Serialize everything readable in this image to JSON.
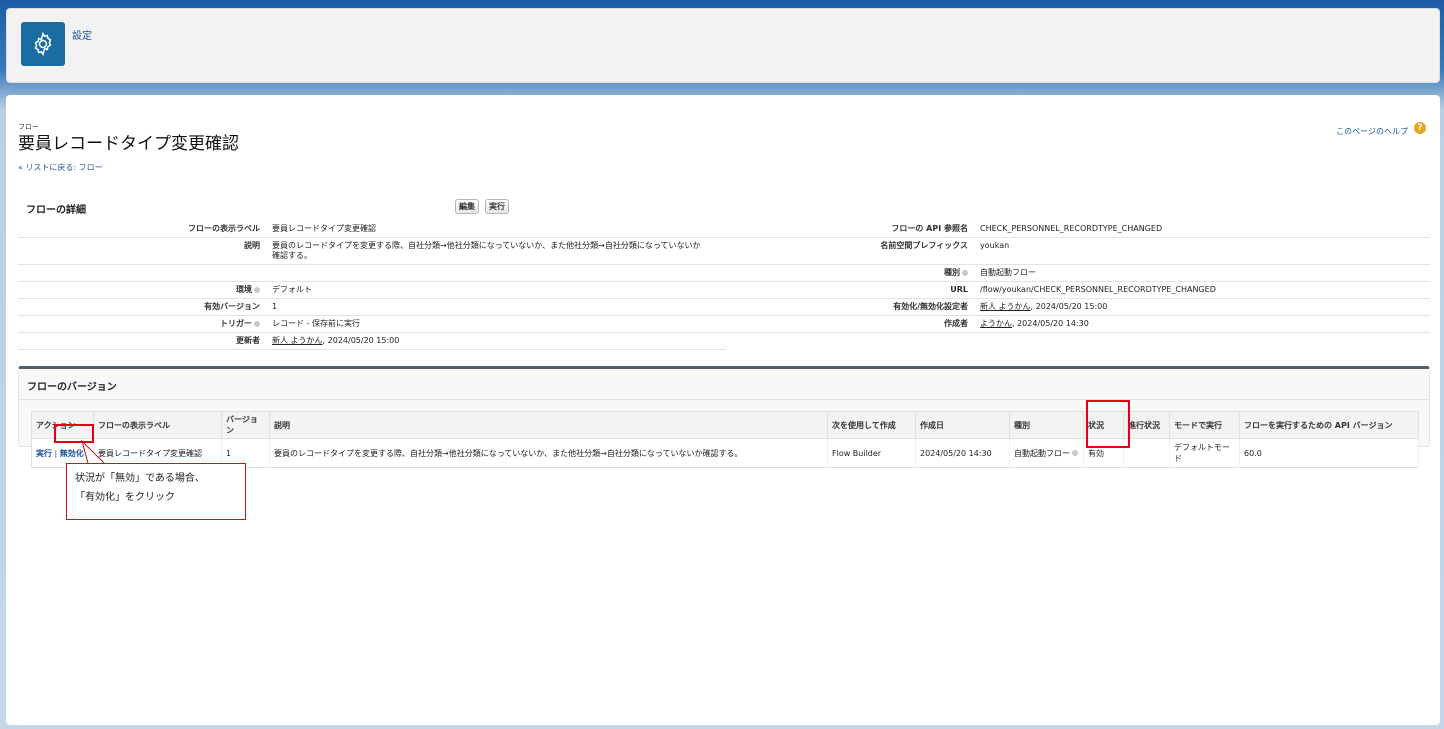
{
  "header": {
    "setup_label": "設定"
  },
  "page": {
    "type_label": "フロー",
    "title": "要員レコードタイプ変更確認",
    "help_link": "このページのヘルプ",
    "help_icon_glyph": "?",
    "back_link": "« リストに戻る: フロー"
  },
  "details": {
    "section_title": "フローの詳細",
    "edit_button": "編集",
    "run_button": "実行",
    "rows": [
      {
        "label": "フローの表示ラベル",
        "value": "要員レコードタイプ変更確認",
        "label2": "フローの API 参照名",
        "value2": "CHECK_PERSONNEL_RECORDTYPE_CHANGED"
      },
      {
        "label": "説明",
        "value": "要員のレコードタイプを変更する際、自社分類→他社分類になっていないか、また他社分類→自社分類になっていないか確認する。",
        "label2": "名前空間プレフィックス",
        "value2": "youkan"
      },
      {
        "label": "",
        "value": "",
        "label2": "種別",
        "value2": "自動起動フロー"
      },
      {
        "label": "環境",
        "value": "デフォルト",
        "label2": "URL",
        "value2": "/flow/youkan/CHECK_PERSONNEL_RECORDTYPE_CHANGED"
      },
      {
        "label": "有効バージョン",
        "value": "1",
        "label2": "有効化/無効化設定者",
        "value2_user": "新人 ようかん",
        "value2_rest": ", 2024/05/20 15:00"
      },
      {
        "label": "トリガー",
        "value": "レコード - 保存前に実行",
        "label2": "作成者",
        "value2_user": "ようかん",
        "value2_rest": ", 2024/05/20 14:30"
      },
      {
        "label": "更新者",
        "value_user": "新人 ようかん",
        "value_rest": ", 2024/05/20 15:00",
        "label2": "",
        "value2": ""
      }
    ]
  },
  "versions": {
    "section_title": "フローのバージョン",
    "columns": [
      "アクション",
      "フローの表示ラベル",
      "バージョン",
      "説明",
      "次を使用して作成",
      "作成日",
      "種別",
      "状況",
      "進行状況",
      "モードで実行",
      "フローを実行するための API バージョン"
    ],
    "row": {
      "action_run": "実行",
      "action_toggle": "無効化",
      "label": "要員レコードタイプ変更確認",
      "version": "1",
      "description": "要員のレコードタイプを変更する際、自社分類→他社分類になっていないか、また他社分類→自社分類になっていないか確認する。",
      "built_with": "Flow Builder",
      "created": "2024/05/20 14:30",
      "type": "自動起動フロー",
      "status": "有効",
      "progress": "",
      "run_mode": "デフォルトモード",
      "api_version": "60.0"
    }
  },
  "annotation": {
    "line1": "状況が「無効」である場合、",
    "line2": "「有効化」をクリック",
    "color": "#e60012"
  }
}
